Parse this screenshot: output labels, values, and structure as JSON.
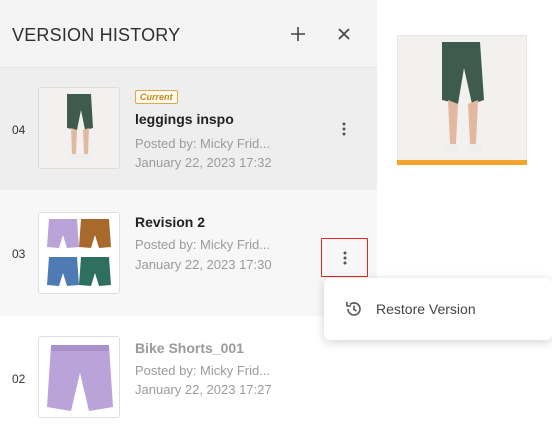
{
  "header": {
    "title": "VERSION HISTORY",
    "add_icon": "plus-icon",
    "close_icon": "close-icon"
  },
  "versions": [
    {
      "number": "04",
      "badge": "Current",
      "name": "leggings inspo",
      "posted_by": "Posted by: Micky Frid...",
      "date": "January 22, 2023 17:32"
    },
    {
      "number": "03",
      "name": "Revision 2",
      "posted_by": "Posted by: Micky Frid...",
      "date": "January 22, 2023 17:30"
    },
    {
      "number": "02",
      "name": "Bike Shorts_001",
      "posted_by": "Posted by: Micky Frid...",
      "date": "January 22, 2023 17:27"
    }
  ],
  "menu": {
    "restore_label": "Restore Version",
    "restore_icon": "history-icon"
  },
  "colors": {
    "accent": "#f4a52b",
    "highlight": "#e02424",
    "badge": "#c48a1f",
    "legging_green": "#3e5b4e",
    "lavender": "#b9a3d9",
    "bronze": "#a8692a",
    "blue": "#4f7bb5",
    "teal": "#2f6f5f"
  }
}
